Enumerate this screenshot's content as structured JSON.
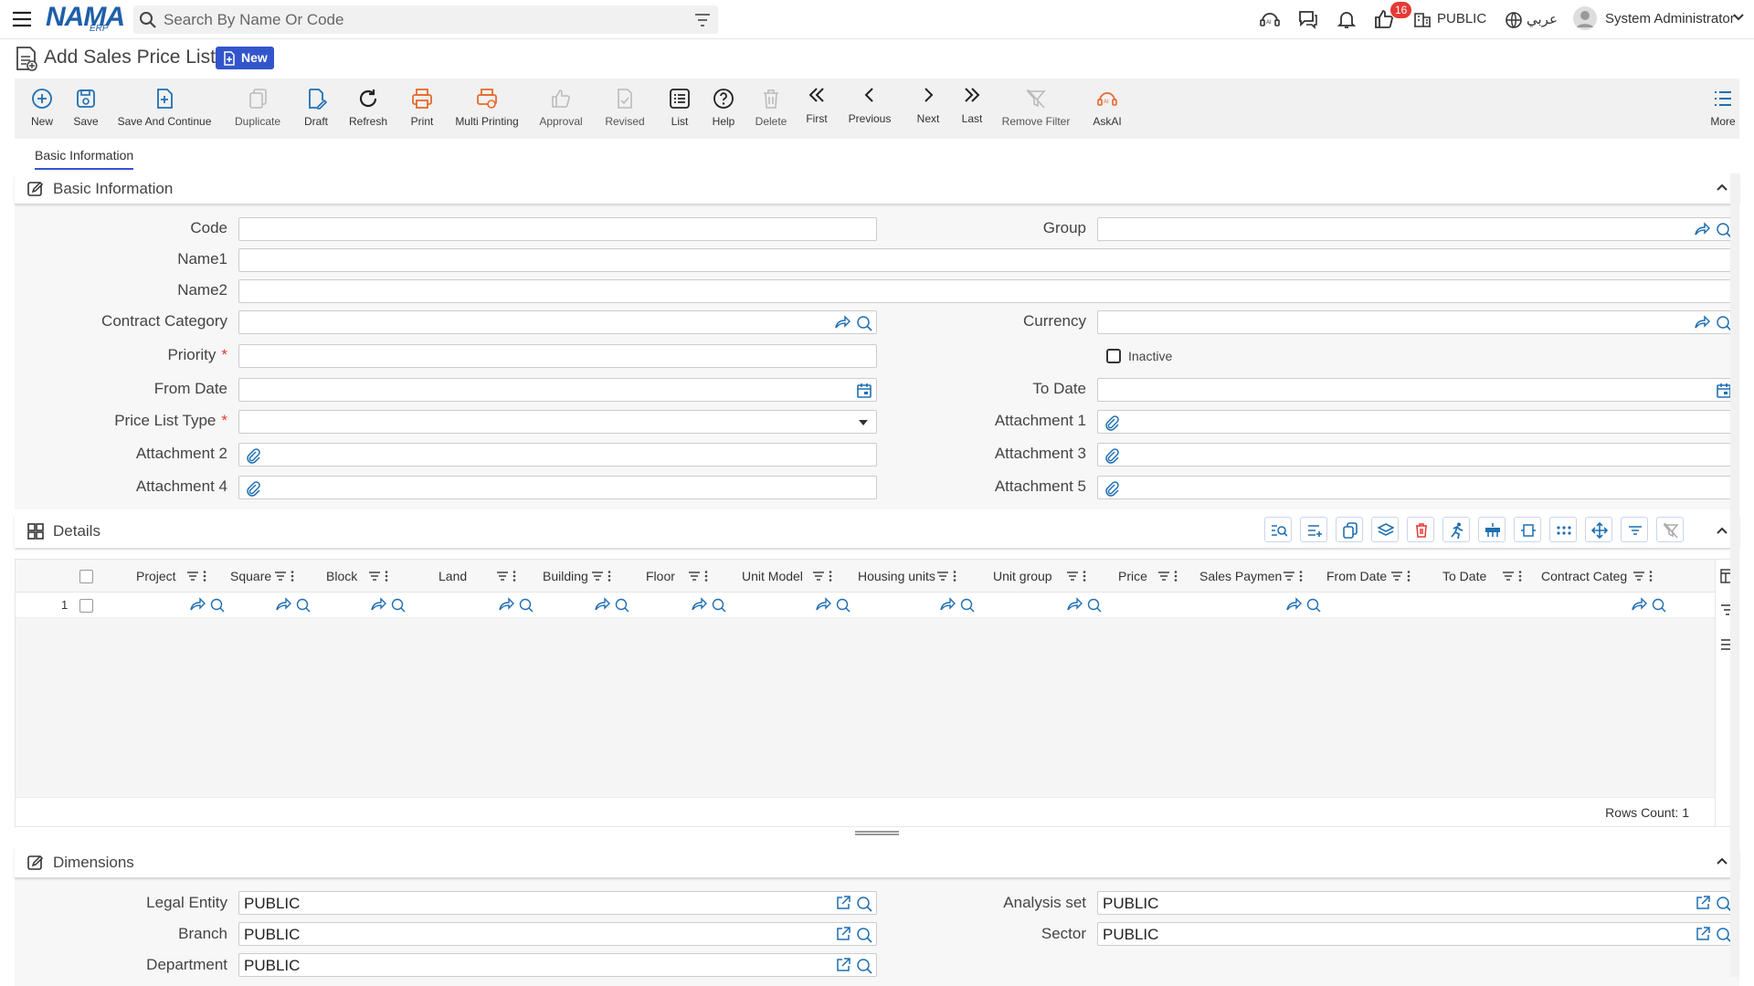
{
  "app": {
    "logo": "NAMA",
    "logo_sub": "ERP"
  },
  "topbar": {
    "search_placeholder": "Search By Name Or Code",
    "badge_count": "16",
    "company": "PUBLIC",
    "language": "عربي",
    "user": "System Administrator"
  },
  "page": {
    "title": "Add Sales Price List",
    "status": "New"
  },
  "toolbar": [
    {
      "label": "New",
      "icon": "plus-circle-icon",
      "enabled": true
    },
    {
      "label": "Save",
      "icon": "save-icon",
      "enabled": true
    },
    {
      "label": "Save And Continue",
      "icon": "save-continue-icon",
      "enabled": true
    },
    {
      "label": "Duplicate",
      "icon": "duplicate-icon",
      "enabled": false
    },
    {
      "label": "Draft",
      "icon": "draft-icon",
      "enabled": true
    },
    {
      "label": "Refresh",
      "icon": "refresh-icon",
      "enabled": true
    },
    {
      "label": "Print",
      "icon": "print-icon",
      "enabled": true
    },
    {
      "label": "Multi Printing",
      "icon": "multi-print-icon",
      "enabled": true
    },
    {
      "label": "Approval",
      "icon": "approval-icon",
      "enabled": false
    },
    {
      "label": "Revised",
      "icon": "revised-icon",
      "enabled": false
    },
    {
      "label": "List",
      "icon": "list-icon",
      "enabled": true
    },
    {
      "label": "Help",
      "icon": "help-icon",
      "enabled": true
    },
    {
      "label": "Delete",
      "icon": "delete-icon",
      "enabled": false
    },
    {
      "label": "First",
      "icon": "first-icon",
      "enabled": true
    },
    {
      "label": "Previous",
      "icon": "previous-icon",
      "enabled": true
    },
    {
      "label": "Next",
      "icon": "next-icon",
      "enabled": true
    },
    {
      "label": "Last",
      "icon": "last-icon",
      "enabled": true
    },
    {
      "label": "Remove Filter",
      "icon": "remove-filter-icon",
      "enabled": false
    },
    {
      "label": "AskAI",
      "icon": "askai-icon",
      "enabled": true
    },
    {
      "label": "More",
      "icon": "more-icon",
      "enabled": true
    }
  ],
  "tabs": [
    "Basic Information"
  ],
  "basic": {
    "title": "Basic Information",
    "code": "Code",
    "group": "Group",
    "name1": "Name1",
    "name2": "Name2",
    "contract_category": "Contract Category",
    "currency": "Currency",
    "priority": "Priority",
    "inactive": "Inactive",
    "from_date": "From Date",
    "to_date": "To Date",
    "price_list_type": "Price List Type",
    "attachment1": "Attachment 1",
    "attachment2": "Attachment 2",
    "attachment3": "Attachment 3",
    "attachment4": "Attachment 4",
    "attachment5": "Attachment 5",
    "required_mark": "*"
  },
  "details": {
    "title": "Details",
    "columns": [
      "Project",
      "Square",
      "Block",
      "Land",
      "Building",
      "Floor",
      "Unit Model",
      "Housing units",
      "Unit group",
      "Price",
      "Sales Paymen",
      "From Date",
      "To Date",
      "Contract Categ"
    ],
    "row_number": "1",
    "rows_count": "Rows Count: 1"
  },
  "dimensions": {
    "title": "Dimensions",
    "legal_entity": {
      "label": "Legal Entity",
      "value": "PUBLIC"
    },
    "analysis_set": {
      "label": "Analysis set",
      "value": "PUBLIC"
    },
    "branch": {
      "label": "Branch",
      "value": "PUBLIC"
    },
    "sector": {
      "label": "Sector",
      "value": "PUBLIC"
    },
    "department": {
      "label": "Department",
      "value": "PUBLIC"
    }
  },
  "colors": {
    "accent": "#3355cc",
    "icon_blue": "#1f6fb2",
    "print_orange": "#e66a2c",
    "badge_red": "#e53935"
  }
}
